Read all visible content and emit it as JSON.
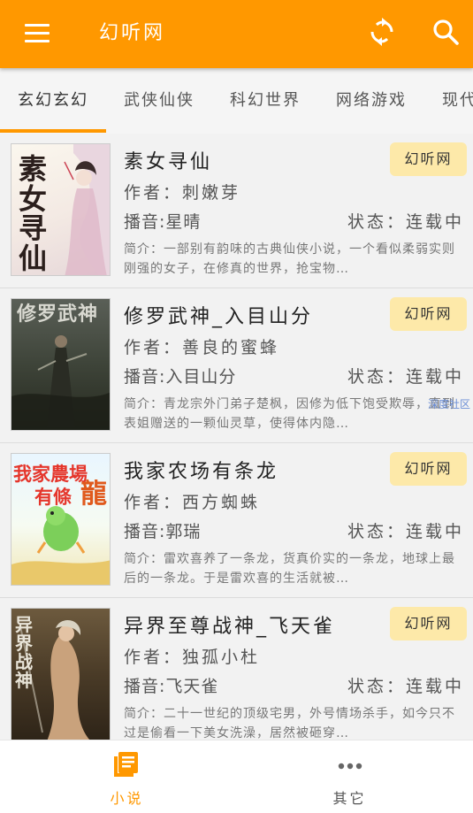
{
  "appbar": {
    "title": "幻听网",
    "icons": {
      "menu": "menu-icon",
      "refresh": "refresh-icon",
      "search": "search-icon"
    }
  },
  "tabs": [
    {
      "label": "玄幻玄幻",
      "active": true
    },
    {
      "label": "武侠仙侠",
      "active": false
    },
    {
      "label": "科幻世界",
      "active": false
    },
    {
      "label": "网络游戏",
      "active": false
    },
    {
      "label": "现代",
      "active": false
    }
  ],
  "books": [
    {
      "title": "素女寻仙",
      "author": "作者：刺嫩芽",
      "narrator": "播音:星晴",
      "status": "状态：连载中",
      "summary": "简介：一部别有韵味的古典仙侠小说，一个看似柔弱实则刚强的女子，在修真的世界，抢宝物…",
      "badge": "幻听网",
      "cover_text": "素女寻仙",
      "cover_author": "刺嫩芽"
    },
    {
      "title": "修罗武神_入目山分",
      "author": "作者：善良的蜜蜂",
      "narrator": "播音:入目山分",
      "status": "状态：连载中",
      "summary": "简介：青龙宗外门弟子楚枫，因修为低下饱受欺辱，直到表姐赠送的一颗仙灵草，使得体内隐…",
      "badge": "幻听网",
      "cover_text": "修罗武神"
    },
    {
      "title": "我家农场有条龙",
      "author": "作者：西方蜘蛛",
      "narrator": "播音:郭瑞",
      "status": "状态：连载中",
      "summary": "简介：雷欢喜养了一条龙，货真价实的一条龙，地球上最后的一条龙。于是雷欢喜的生活就被…",
      "badge": "幻听网",
      "cover_text_1": "我家農場",
      "cover_text_2": "有條",
      "cover_text_3": "龍"
    },
    {
      "title": "异界至尊战神_飞天雀",
      "author": "作者：独孤小杜",
      "narrator": "播音:飞天雀",
      "status": "状态：连载中",
      "summary": "简介：二十一世纪的顶级宅男，外号情场杀手，如今只不过是偷看一下美女洗澡，居然被砸穿…",
      "badge": "幻听网",
      "cover_text": "异界战神"
    }
  ],
  "watermark": "深度社区",
  "bottomnav": {
    "items": [
      {
        "label": "小说",
        "icon": "book-list-icon",
        "active": true
      },
      {
        "label": "其它",
        "icon": "more-dots-icon",
        "active": false
      }
    ]
  },
  "colors": {
    "primary": "#ff9800",
    "badge_bg": "#fde9a9",
    "nav_active": "#ff9800",
    "nav_inactive": "#555555"
  }
}
